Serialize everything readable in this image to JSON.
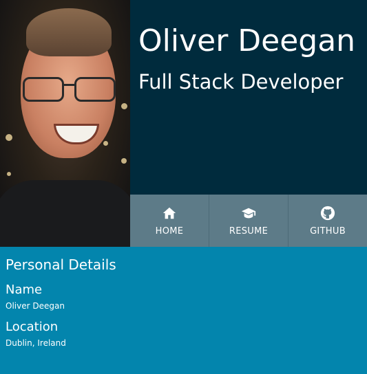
{
  "header": {
    "name": "Oliver Deegan",
    "role": "Full Stack Developer"
  },
  "nav": {
    "items": [
      {
        "label": "HOME",
        "icon": "home-icon"
      },
      {
        "label": "RESUME",
        "icon": "graduation-cap-icon"
      },
      {
        "label": "GITHUB",
        "icon": "github-icon"
      }
    ]
  },
  "details": {
    "title": "Personal Details",
    "fields": [
      {
        "label": "Name",
        "value": "Oliver Deegan"
      },
      {
        "label": "Location",
        "value": "Dublin, Ireland"
      }
    ]
  },
  "colors": {
    "header_bg": "#002b3d",
    "nav_bg": "#5d7b88",
    "details_bg": "#0385ad",
    "text": "#ffffff"
  }
}
